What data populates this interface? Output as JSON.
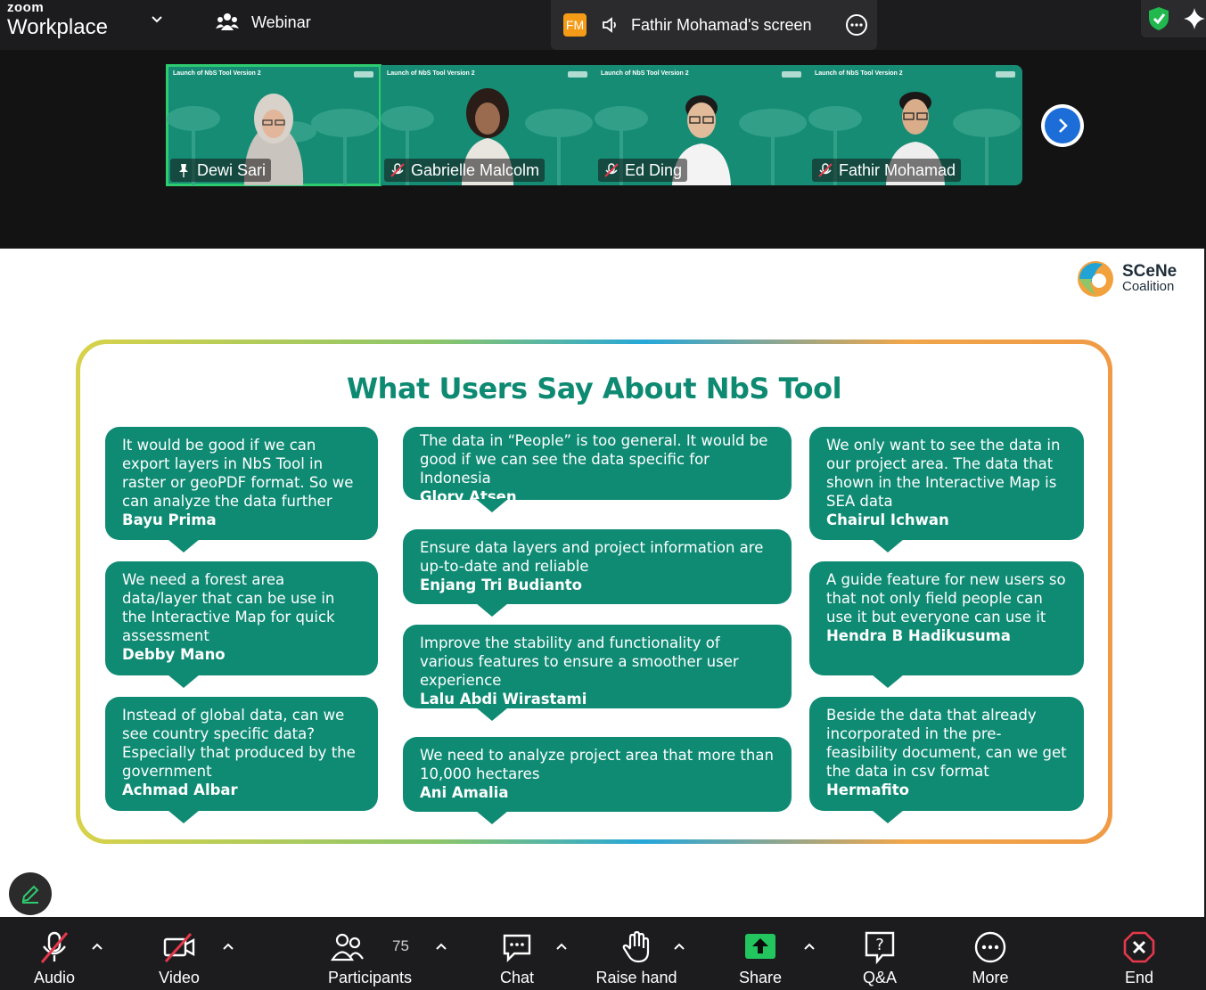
{
  "app": {
    "brand_top": "zoom",
    "brand_name": "Workplace"
  },
  "topbar": {
    "meeting_type": "Webinar",
    "sharer_initials": "FM",
    "screen_label": "Fathir Mohamad's screen"
  },
  "participants_strip": [
    {
      "name": "Dewi Sari",
      "slide_title": "Launch of NbS Tool Version 2",
      "active": true
    },
    {
      "name": "Gabrielle Malcolm",
      "slide_title": "Launch of NbS Tool Version 2",
      "active": false
    },
    {
      "name": "Ed Ding",
      "slide_title": "Launch of NbS Tool Version 2",
      "active": false
    },
    {
      "name": "Fathir Mohamad",
      "slide_title": "Launch of NbS Tool Version 2",
      "active": false
    }
  ],
  "slide": {
    "logo_line1": "SCeNe",
    "logo_line2": "Coalition",
    "title": "What Users Say About NbS Tool",
    "quotes_left": [
      {
        "text": "It would be good if we can export layers in NbS Tool in raster or geoPDF format. So we can analyze the data further",
        "author": "Bayu Prima"
      },
      {
        "text": "We need a forest area data/layer that can be use in the Interactive Map for quick assessment",
        "author": "Debby Mano"
      },
      {
        "text": "Instead of global data, can we see country specific data? Especially that produced by the government",
        "author": "Achmad Albar"
      }
    ],
    "quotes_mid": [
      {
        "text": "The data in “People” is too general. It would be good if we can see the data specific for Indonesia",
        "author": "Glory Atsen"
      },
      {
        "text": "Ensure data layers and project information are up-to-date and reliable",
        "author": "Enjang Tri Budianto"
      },
      {
        "text": "Improve the stability and functionality of various features to ensure a smoother user experience",
        "author": "Lalu Abdi Wirastami"
      },
      {
        "text": "We need to analyze project area that more than 10,000 hectares",
        "author": "Ani Amalia"
      }
    ],
    "quotes_right": [
      {
        "text": "We only want to see the data in our project area. The data that shown in the Interactive Map is SEA data",
        "author": "Chairul Ichwan"
      },
      {
        "text": "A guide feature for new users so that not only field people can use it but everyone can use it",
        "author": "Hendra B Hadikusuma"
      },
      {
        "text": "Beside the data that already incorporated in the pre-feasibility document, can we get the data in csv format",
        "author": "Hermafito"
      }
    ]
  },
  "toolbar": {
    "audio": "Audio",
    "video": "Video",
    "participants": "Participants",
    "participants_count": "75",
    "chat": "Chat",
    "raise_hand": "Raise hand",
    "share": "Share",
    "qa": "Q&A",
    "more": "More",
    "end": "End"
  },
  "colors": {
    "accent_green": "#0f8b74",
    "share_green": "#22c55e",
    "end_red": "#e5384b",
    "active_tile": "#2ecc71"
  }
}
